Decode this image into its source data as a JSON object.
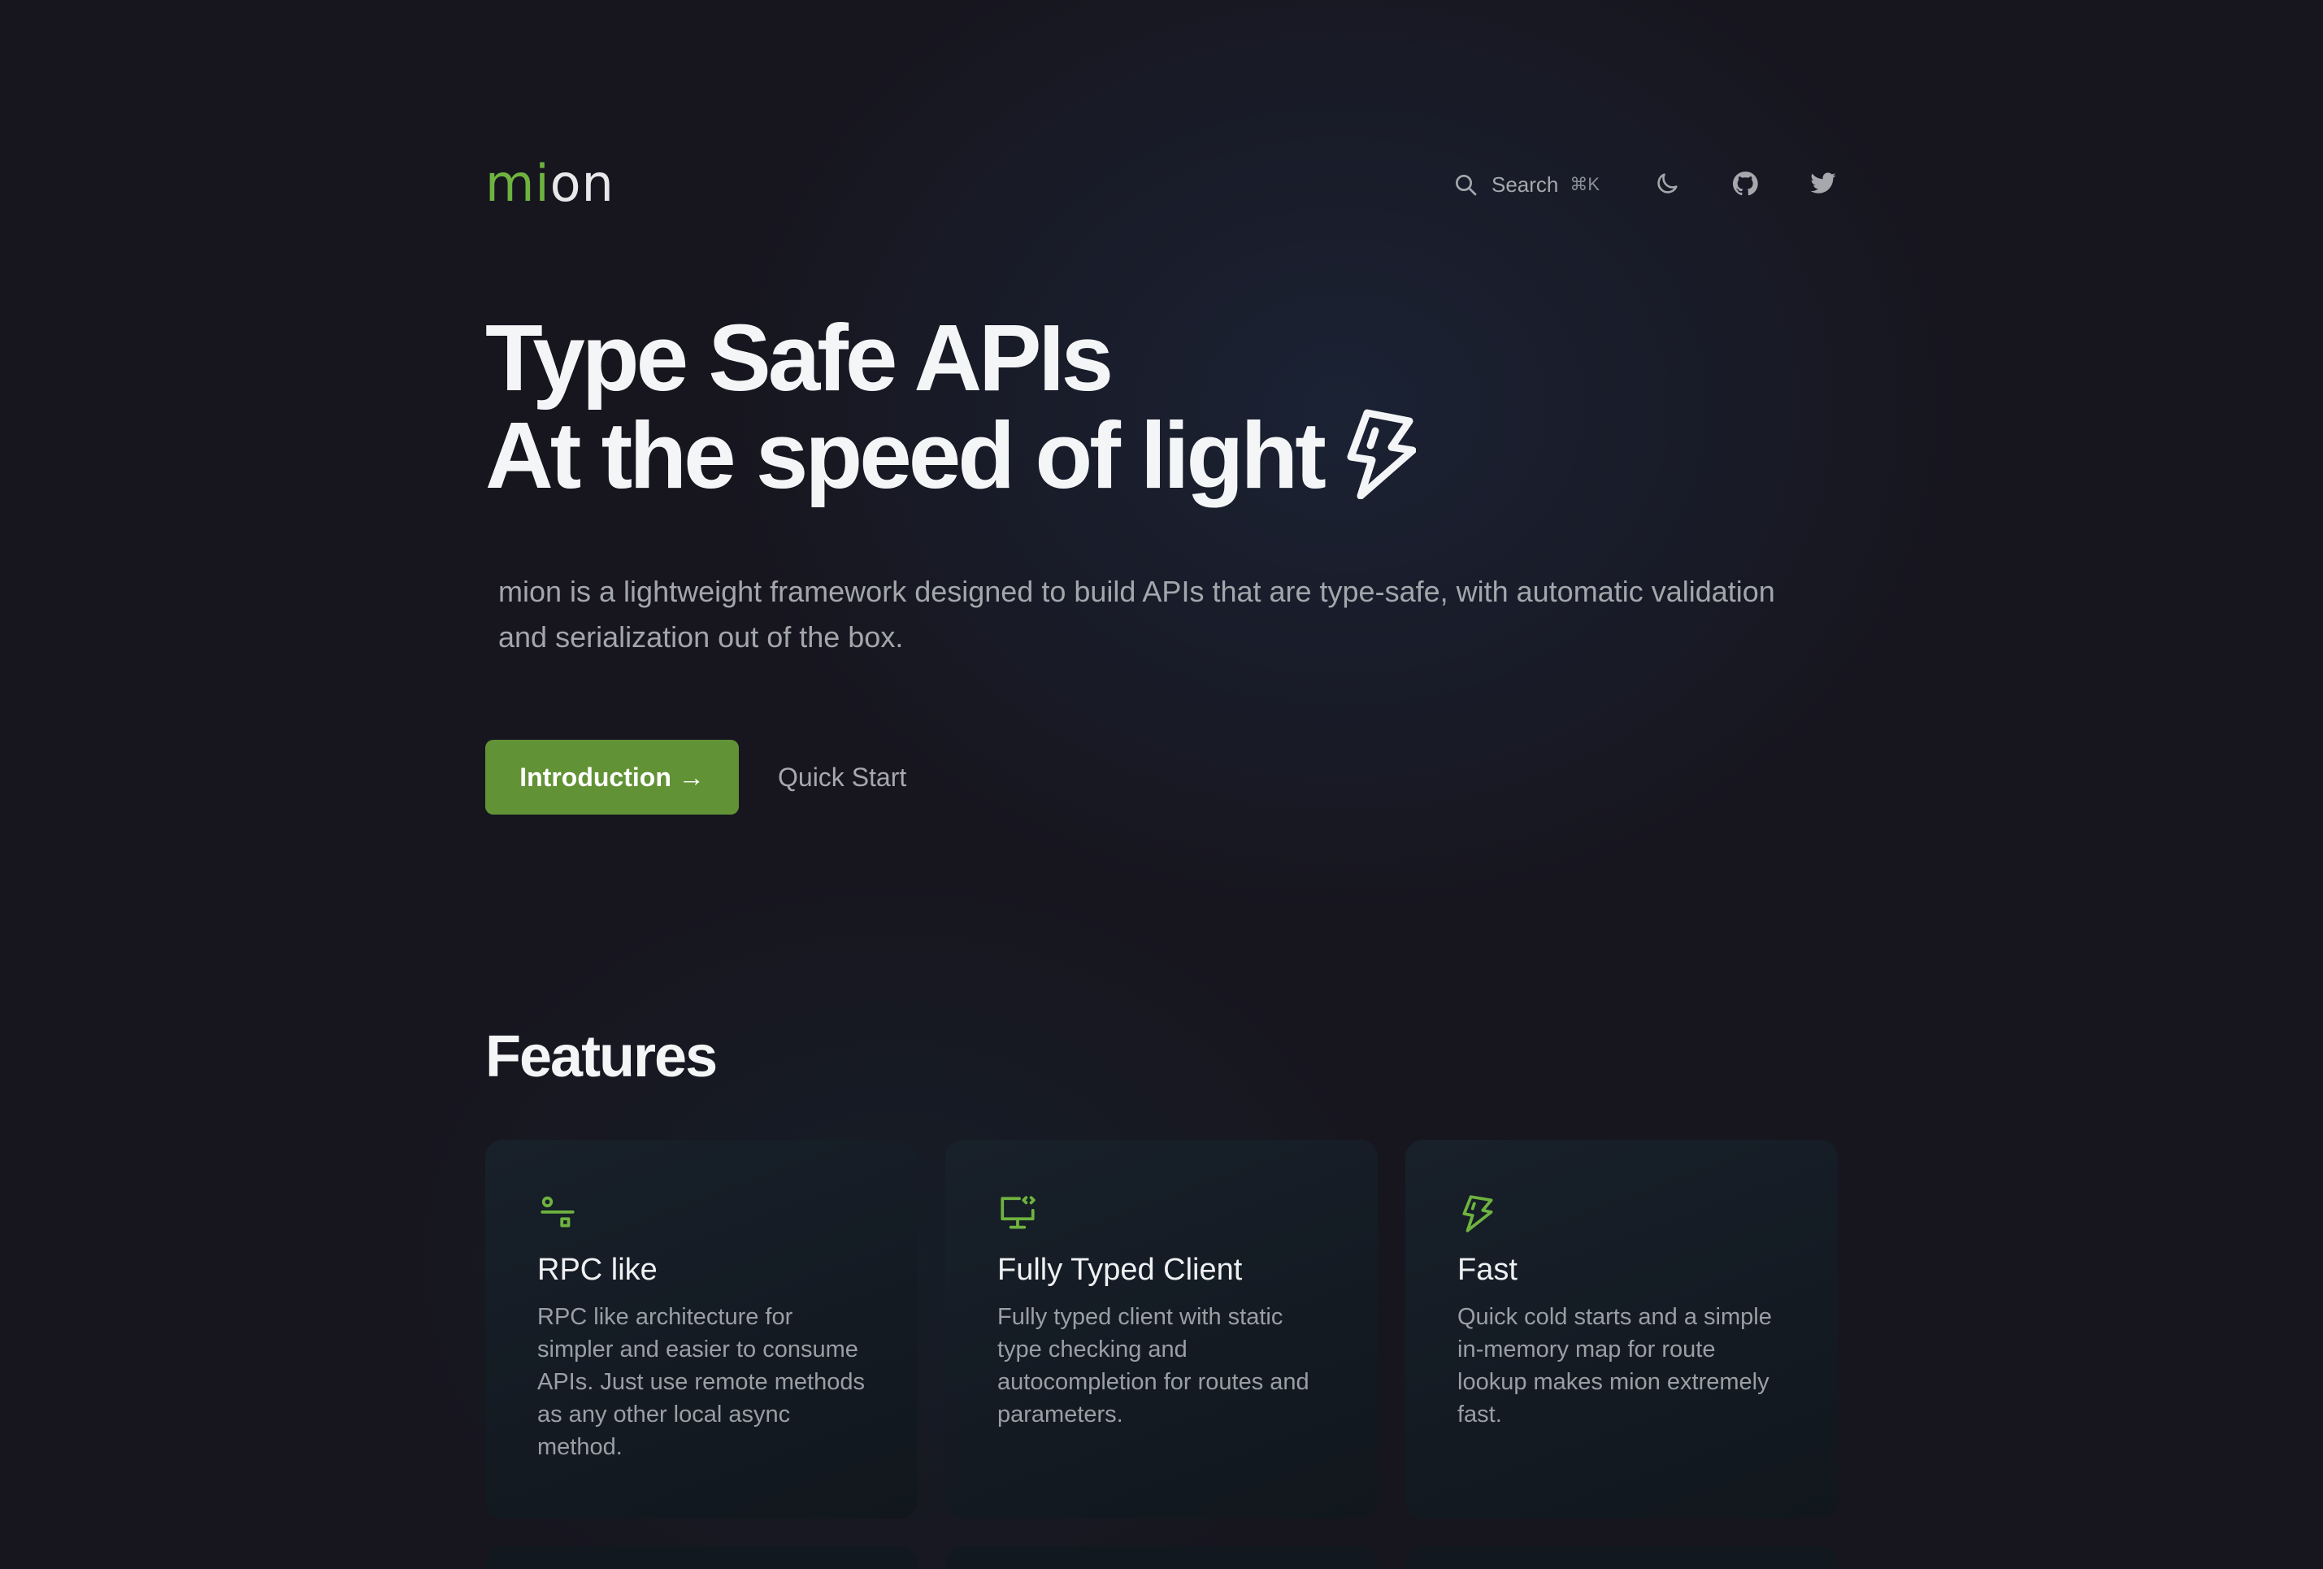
{
  "header": {
    "logo_prefix": "mi",
    "logo_suffix": "on",
    "search_label": "Search",
    "search_shortcut": "⌘K",
    "icons": [
      "search-icon",
      "moon-icon",
      "github-icon",
      "twitter-icon"
    ]
  },
  "hero": {
    "title_line1": "Type Safe APIs",
    "title_line2": "At the speed of light",
    "title_icon": "lightning-icon",
    "description": "mion is a lightweight framework designed to build APIs that are type-safe, with automatic validation and serialization out of the box.",
    "primary_button": "Introduction →",
    "secondary_button": "Quick Start"
  },
  "features": {
    "title": "Features",
    "items": [
      {
        "icon": "routes-icon",
        "title": "RPC like",
        "description": "RPC like architecture for simpler and easier to consume APIs. Just use remote methods as any other local async method."
      },
      {
        "icon": "monitor-code-icon",
        "title": "Fully Typed Client",
        "description": "Fully typed client with static type checking and autocompletion for routes and parameters."
      },
      {
        "icon": "lightning-icon",
        "title": "Fast",
        "description": "Quick cold starts and a simple in-memory map for route lookup makes mion extremely fast."
      }
    ]
  },
  "colors": {
    "background": "#17161f",
    "accent": "#6eb33f",
    "button": "#629236",
    "card": "#151c24"
  }
}
